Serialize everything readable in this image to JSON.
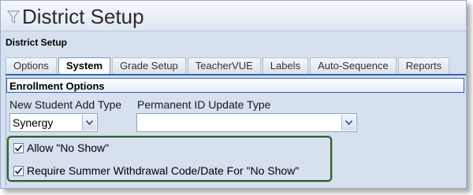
{
  "window": {
    "title": "District Setup"
  },
  "subheader": "District Setup",
  "tabs": [
    {
      "label": "Options",
      "active": false
    },
    {
      "label": "System",
      "active": true
    },
    {
      "label": "Grade Setup",
      "active": false
    },
    {
      "label": "TeacherVUE",
      "active": false
    },
    {
      "label": "Labels",
      "active": false
    },
    {
      "label": "Auto-Sequence",
      "active": false
    },
    {
      "label": "Reports",
      "active": false
    }
  ],
  "section": {
    "title": "Enrollment Options",
    "new_student_add_type": {
      "label": "New Student Add Type",
      "value": "Synergy"
    },
    "permanent_id_update_type": {
      "label": "Permanent ID Update Type",
      "value": ""
    },
    "allow_no_show": {
      "label": "Allow \"No Show\"",
      "checked": true
    },
    "require_summer_withdrawal": {
      "label": "Require Summer Withdrawal Code/Date For \"No Show\"",
      "checked": true
    }
  },
  "colors": {
    "accent": "#2f63b5",
    "panel_bg": "#d6e0ef",
    "highlight": "#2e5a2e"
  }
}
